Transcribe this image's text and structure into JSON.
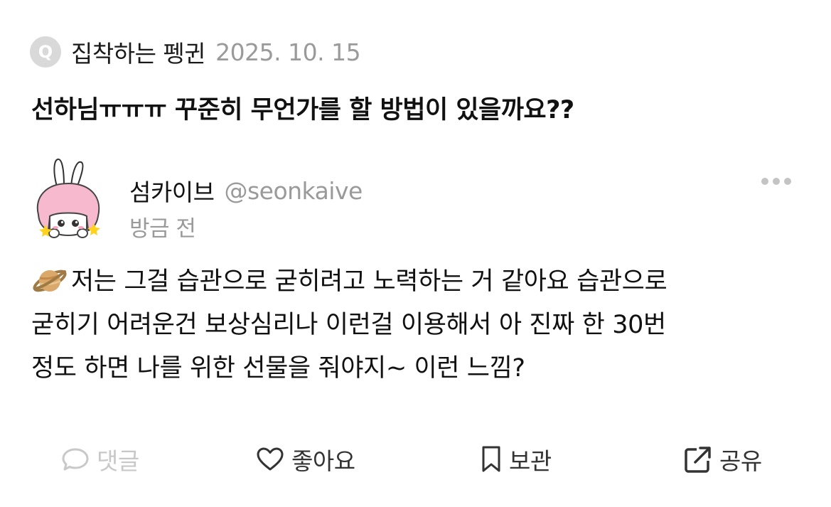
{
  "question": {
    "badge": "Q",
    "asker": "집착하는 펭귄",
    "date": "2025. 10. 15",
    "text": "선하님ㅠㅠㅠ 꾸준히 무언가를 할 방법이 있을까요??"
  },
  "answer": {
    "author_name": "섬카이브",
    "author_handle": "@seonkaive",
    "time": "방금 전",
    "emoji_icon": "ringed-planet-icon",
    "lines": [
      "저는 그걸 습관으로 굳히려고 노력하는 거 같아요 습관으로",
      "굳히기 어려운건 보상심리나 이런걸 이용해서 아 진짜 한 30번",
      "정도 하면 나를 위한 선물을 줘야지~ 이런 느낌?"
    ]
  },
  "actions": {
    "comment_label": "댓글",
    "like_label": "좋아요",
    "save_label": "보관",
    "share_label": "공유"
  },
  "colors": {
    "muted_text": "#9a9a9a",
    "disabled": "#c8c8c8",
    "primary_text": "#111111",
    "badge_bg": "#d9d9d9"
  }
}
